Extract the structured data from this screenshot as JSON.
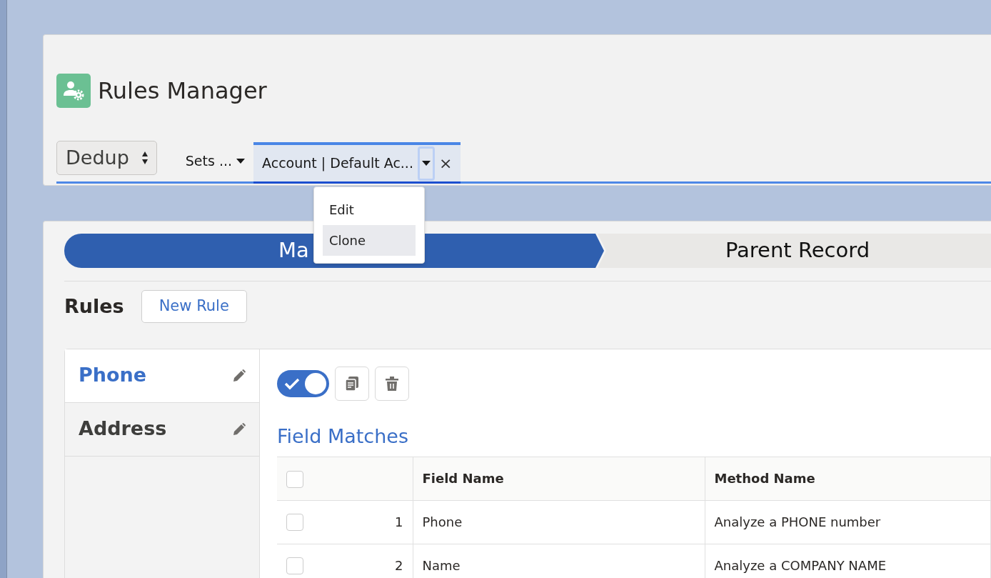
{
  "app": {
    "title": "Rules Manager"
  },
  "mode_select": {
    "value": "Dedup"
  },
  "tabs": [
    {
      "label": "Sets ...",
      "selected": false
    },
    {
      "label": "Account | Default Ac...",
      "selected": true,
      "close_glyph": "×"
    }
  ],
  "tab_menu": {
    "items": [
      {
        "label": "Edit",
        "selected": false
      },
      {
        "label": "Clone",
        "selected": true
      }
    ]
  },
  "path": [
    {
      "label": "Ma",
      "selected": true
    },
    {
      "label": "Parent Record",
      "selected": false
    }
  ],
  "rules_header": {
    "title": "Rules",
    "button": "New Rule"
  },
  "rules": [
    {
      "name": "Phone",
      "selected": true
    },
    {
      "name": "Address",
      "selected": false
    }
  ],
  "rule_toolbar": {
    "active": true
  },
  "field_matches": {
    "title": "Field Matches",
    "header_checked": false,
    "columns": [
      "Field Name",
      "Method Name"
    ],
    "rows": [
      {
        "index": "1",
        "field": "Phone",
        "method": "Analyze a PHONE number",
        "checked": false
      },
      {
        "index": "2",
        "field": "Name",
        "method": "Analyze a COMPANY NAME",
        "checked": false
      }
    ]
  }
}
